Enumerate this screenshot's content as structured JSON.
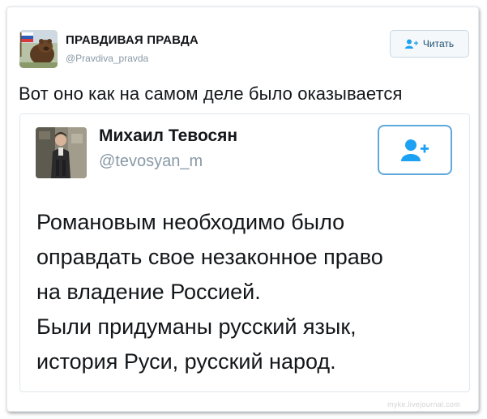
{
  "tweet": {
    "author_name": "ПРАВДИВАЯ ПРАВДА",
    "author_handle": "@Pravdiva_pravda",
    "follow_label": "Читать",
    "text": "Вот оно как на самом деле было оказывается"
  },
  "quoted_tweet": {
    "author_name": "Михаил Тевосян",
    "author_handle": "@tevosyan_m",
    "text_lines": [
      "Романовым необходимо было",
      "оправдать свое незаконное право",
      "на владение Россией.",
      "Были придуманы русский язык,",
      "история Руси, русский народ."
    ]
  },
  "watermark": "myke.livejournal.com",
  "colors": {
    "text": "#14171a",
    "handle": "#8899a6",
    "accent_blue": "#1da1f2",
    "border": "#e1e8ed"
  },
  "icons": {
    "avatar_main": "bear-with-flag-avatar",
    "avatar_quoted": "man-portrait-avatar",
    "follow": "add-user-icon"
  }
}
